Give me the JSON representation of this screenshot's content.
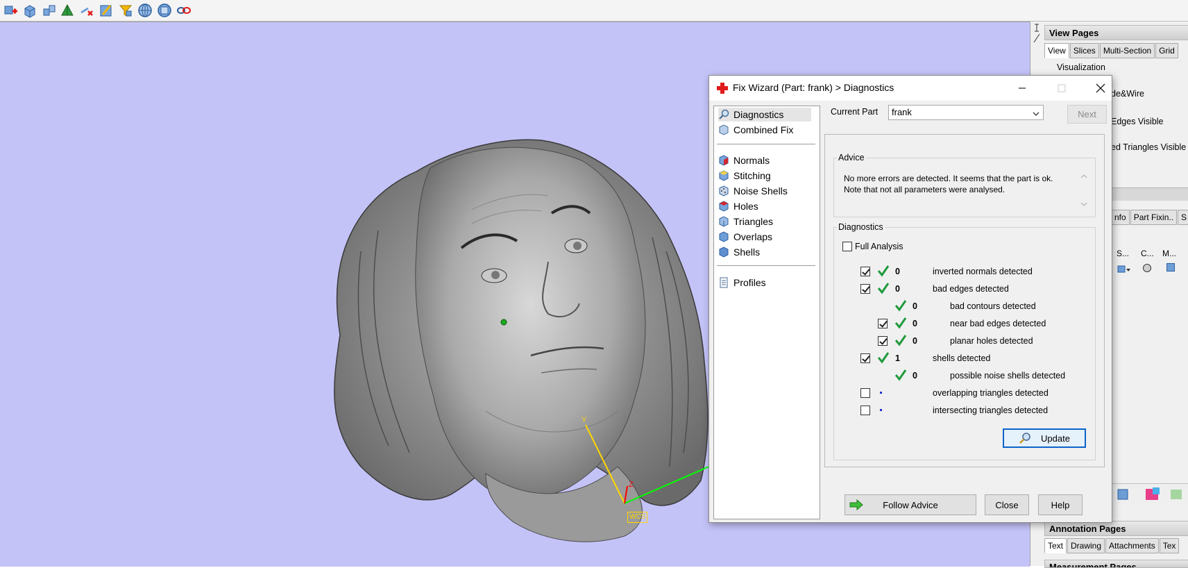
{
  "toolbar": {
    "icons": [
      "new-part-icon",
      "open-box-icon",
      "boxes-icon",
      "pyramid-icon",
      "delete-selection-icon",
      "edit-triangle-icon",
      "funnel-icon",
      "globe-view-icon",
      "globe-view-2-icon",
      "link-icon"
    ]
  },
  "viewport": {
    "axis_y": "Y",
    "axis_z": "Z",
    "wcs_label": "WCS",
    "colors": {
      "background": "#c4c3f8",
      "x_axis": "#00ff00",
      "y_axis": "#ffd800",
      "z_axis": "#ff0000"
    }
  },
  "right_panel": {
    "view_pages_title": "View Pages",
    "view_tabs": [
      "View",
      "Slices",
      "Multi-Section",
      "Grid"
    ],
    "visualization_label": "Visualization",
    "option1": "de&Wire",
    "option2": "Edges Visible",
    "option3": "ed Triangles Visible",
    "tabs2": [
      "nfo",
      "Part Fixin..",
      "S"
    ],
    "columns": [
      "S...",
      "C...",
      "M..."
    ],
    "annotation_title": "Annotation Pages",
    "annotation_tabs": [
      "Text",
      "Drawing",
      "Attachments",
      "Tex"
    ],
    "measurement_title": "Measurement Pages"
  },
  "dialog": {
    "title": "Fix Wizard (Part: frank) > Diagnostics",
    "nav": {
      "diagnostics": "Diagnostics",
      "combined_fix": "Combined Fix",
      "normals": "Normals",
      "stitching": "Stitching",
      "noise_shells": "Noise Shells",
      "holes": "Holes",
      "triangles": "Triangles",
      "overlaps": "Overlaps",
      "shells": "Shells",
      "profiles": "Profiles"
    },
    "current_part_label": "Current Part",
    "current_part_value": "frank",
    "next_label": "Next",
    "advice_title": "Advice",
    "advice_text": "No more errors are detected. It seems that the part is ok. Note that not all parameters were analysed.",
    "diagnostics_title": "Diagnostics",
    "full_analysis_label": "Full Analysis",
    "rows": [
      {
        "count": "0",
        "label": "inverted normals detected"
      },
      {
        "count": "0",
        "label": "bad edges detected"
      },
      {
        "count": "0",
        "label": "bad contours detected"
      },
      {
        "count": "0",
        "label": "near bad edges detected"
      },
      {
        "count": "0",
        "label": "planar holes detected"
      },
      {
        "count": "1",
        "label": "shells detected"
      },
      {
        "count": "0",
        "label": "possible noise shells detected"
      },
      {
        "count": "",
        "label": "overlapping triangles detected"
      },
      {
        "count": "",
        "label": "intersecting triangles detected"
      }
    ],
    "update_label": "Update",
    "follow_advice_label": "Follow Advice",
    "close_label": "Close",
    "help_label": "Help",
    "colors": {
      "check_green": "#1f9a3c",
      "accent_blue": "#0b63c9",
      "title_red": "#e01b1b"
    }
  }
}
